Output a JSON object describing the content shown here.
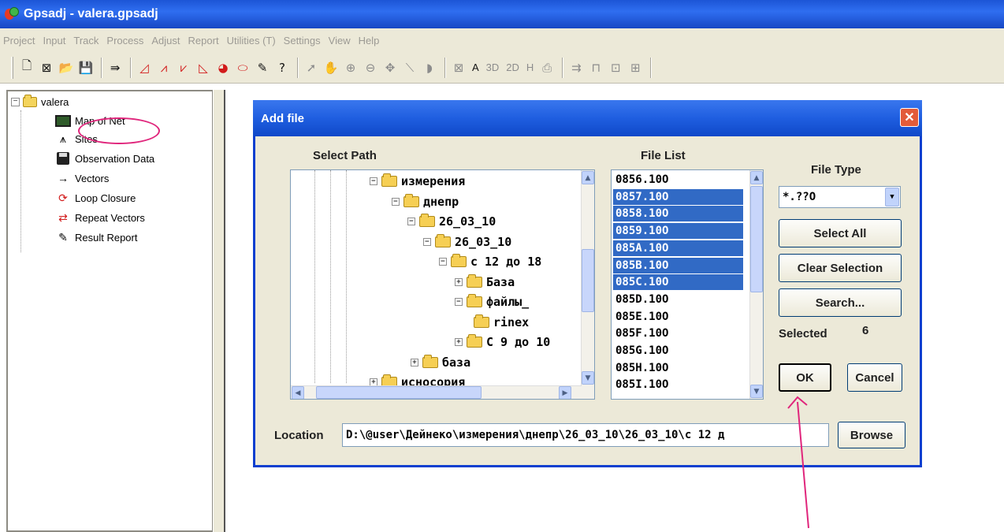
{
  "window": {
    "title": "Gpsadj - valera.gpsadj"
  },
  "menu": [
    "Project",
    "Input",
    "Track",
    "Process",
    "Adjust",
    "Report",
    "Utilities (T)",
    "Settings",
    "View",
    "Help"
  ],
  "toolbar": {
    "labels": {
      "a": "A",
      "three_d": "3D",
      "two_d": "2D",
      "h": "H"
    }
  },
  "project_tree": {
    "root": "valera",
    "items": [
      "Map of Net",
      "Sites",
      "Observation Data",
      "Vectors",
      "Loop Closure",
      "Repeat Vectors",
      "Result Report"
    ]
  },
  "dialog": {
    "title": "Add file",
    "select_path_label": "Select Path",
    "file_list_label": "File List",
    "file_type_label": "File Type",
    "path_tree": [
      {
        "label": "измерения",
        "exp": "⊟"
      },
      {
        "label": "днепр",
        "exp": "⊟"
      },
      {
        "label": "26_03_10",
        "exp": "⊟"
      },
      {
        "label": "26_03_10",
        "exp": "⊟"
      },
      {
        "label": "с 12 до 18",
        "exp": "⊟"
      },
      {
        "label": "База",
        "exp": "⊞"
      },
      {
        "label": "файлы_",
        "exp": "⊟"
      },
      {
        "label": "rinex",
        "exp": ""
      },
      {
        "label": "С 9 до 10",
        "exp": "⊞"
      },
      {
        "label": "база",
        "exp": "⊞"
      },
      {
        "label": "исносория",
        "exp": "⊞"
      }
    ],
    "files": [
      "0856.10O",
      "0857.10O",
      "0858.10O",
      "0859.10O",
      "085A.10O",
      "085B.10O",
      "085C.10O",
      "085D.10O",
      "085E.10O",
      "085F.10O",
      "085G.10O",
      "085H.10O",
      "085I.10O"
    ],
    "selected_files": [
      1,
      2,
      3,
      4,
      5,
      6
    ],
    "file_type_value": "*.??O",
    "buttons": {
      "select_all": "Select All",
      "clear_selection": "Clear Selection",
      "search": "Search...",
      "ok": "OK",
      "cancel": "Cancel",
      "browse": "Browse"
    },
    "selected_label": "Selected",
    "selected_count": "6",
    "location_label": "Location",
    "location_value": "D:\\@user\\Дейнеко\\измерения\\днепр\\26_03_10\\26_03_10\\с 12 д"
  },
  "colors": {
    "titlebar": "#1f5ee0",
    "selection": "#316ac5",
    "annotation": "#e0267c"
  }
}
